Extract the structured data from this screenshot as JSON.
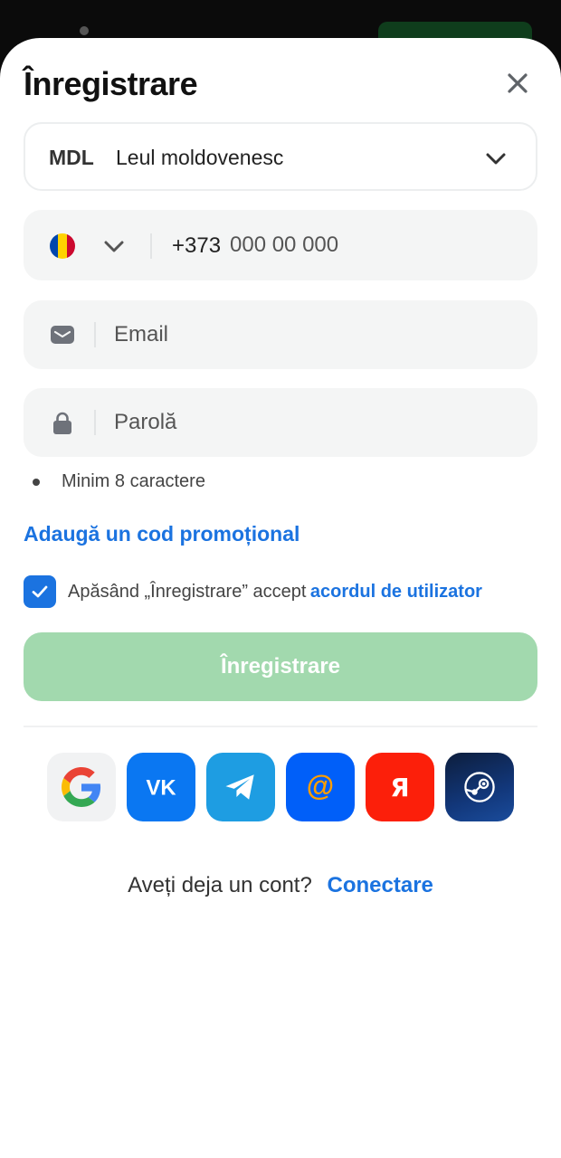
{
  "form": {
    "title": "Înregistrare",
    "currency": {
      "code": "MDL",
      "name": "Leul moldovenesc"
    },
    "phone": {
      "prefix": "+373",
      "placeholder": "000 00 000",
      "flag_colors": [
        "#0046ae",
        "#ffd200",
        "#cc092f"
      ]
    },
    "email": {
      "placeholder": "Email"
    },
    "password": {
      "placeholder": "Parolă"
    },
    "password_hint": "Minim 8 caractere",
    "promo_link": "Adaugă un cod promoțional",
    "agreement": {
      "text": "Apăsând „Înregistrare” accept",
      "link": "acordul de utilizator",
      "checked": true
    },
    "submit_label": "Înregistrare"
  },
  "socials": [
    "google-icon",
    "vk-icon",
    "telegram-icon",
    "mail-ru-icon",
    "yandex-icon",
    "steam-icon"
  ],
  "footer": {
    "prompt": "Aveți deja un cont?",
    "link": "Conectare"
  },
  "colors": {
    "accent": "#1b73e0",
    "submit_disabled": "#a2d9ae",
    "field_bg": "#f4f5f5"
  }
}
